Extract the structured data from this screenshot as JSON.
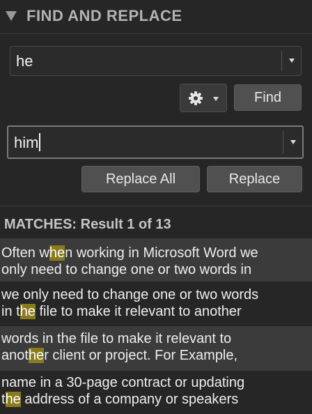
{
  "panel": {
    "title": "FIND AND REPLACE"
  },
  "find": {
    "value": "he",
    "button_label": "Find",
    "options_icon": "gear-icon"
  },
  "replace": {
    "value": "him",
    "replace_all_label": "Replace All",
    "replace_label": "Replace"
  },
  "matches": {
    "title": "MATCHES: Result 1 of 13",
    "highlight_color": "#8a7a1e",
    "results": [
      {
        "lines": [
          {
            "before": "Often w",
            "match": "he",
            "after": "n working in Microsoft Word we"
          },
          {
            "before": "only need to change one or two words in",
            "match": "",
            "after": ""
          }
        ]
      },
      {
        "lines": [
          {
            "before": "we only need to change one or two words",
            "match": "",
            "after": ""
          },
          {
            "before": "in t",
            "match": "he",
            "after": " file to make it relevant to another"
          }
        ]
      },
      {
        "lines": [
          {
            "before": "words in the file to make it relevant to",
            "match": "",
            "after": ""
          },
          {
            "before": "anot",
            "match": "he",
            "after": "r client or project. For Example,"
          }
        ]
      },
      {
        "lines": [
          {
            "before": "name in a 30-page contract or updating",
            "match": "",
            "after": ""
          },
          {
            "before": "t",
            "match": "he",
            "after": " address of a company or speakers"
          }
        ]
      }
    ]
  }
}
